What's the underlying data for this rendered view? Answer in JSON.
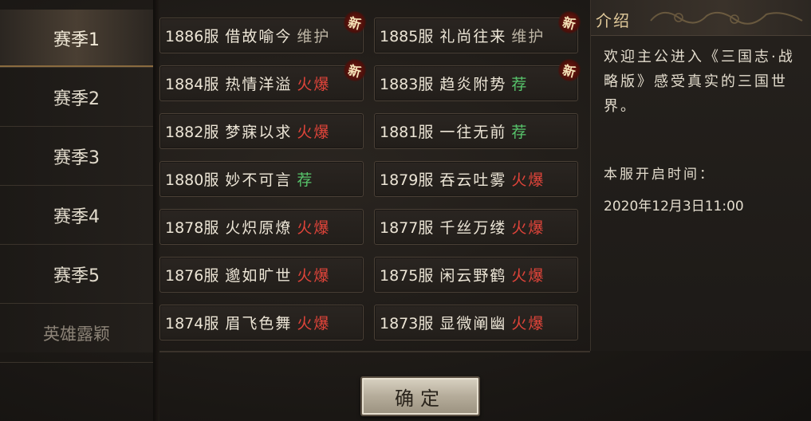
{
  "sidebar": {
    "seasons": [
      {
        "label": "赛季1",
        "active": true
      },
      {
        "label": "赛季2",
        "active": false
      },
      {
        "label": "赛季3",
        "active": false
      },
      {
        "label": "赛季4",
        "active": false
      },
      {
        "label": "赛季5",
        "active": false
      },
      {
        "label": "英雄露颖",
        "active": false
      }
    ]
  },
  "servers": [
    {
      "num": "1886服",
      "name": "借故喻今",
      "status": "维护",
      "status_type": "maintenance",
      "is_new": true,
      "new_label": "新"
    },
    {
      "num": "1885服",
      "name": "礼尚往来",
      "status": "维护",
      "status_type": "maintenance",
      "is_new": true,
      "new_label": "新"
    },
    {
      "num": "1884服",
      "name": "热情洋溢",
      "status": "火爆",
      "status_type": "hot",
      "is_new": true,
      "new_label": "新"
    },
    {
      "num": "1883服",
      "name": "趋炎附势",
      "status": "荐",
      "status_type": "recommended",
      "is_new": true,
      "new_label": "新"
    },
    {
      "num": "1882服",
      "name": "梦寐以求",
      "status": "火爆",
      "status_type": "hot",
      "is_new": false
    },
    {
      "num": "1881服",
      "name": "一往无前",
      "status": "荐",
      "status_type": "recommended",
      "is_new": false
    },
    {
      "num": "1880服",
      "name": "妙不可言",
      "status": "荐",
      "status_type": "recommended",
      "is_new": false
    },
    {
      "num": "1879服",
      "name": "吞云吐雾",
      "status": "火爆",
      "status_type": "hot",
      "is_new": false
    },
    {
      "num": "1878服",
      "name": "火炽原燎",
      "status": "火爆",
      "status_type": "hot",
      "is_new": false
    },
    {
      "num": "1877服",
      "name": "千丝万缕",
      "status": "火爆",
      "status_type": "hot",
      "is_new": false
    },
    {
      "num": "1876服",
      "name": "邈如旷世",
      "status": "火爆",
      "status_type": "hot",
      "is_new": false
    },
    {
      "num": "1875服",
      "name": "闲云野鹤",
      "status": "火爆",
      "status_type": "hot",
      "is_new": false
    },
    {
      "num": "1874服",
      "name": "眉飞色舞",
      "status": "火爆",
      "status_type": "hot",
      "is_new": false
    },
    {
      "num": "1873服",
      "name": "显微阐幽",
      "status": "火爆",
      "status_type": "hot",
      "is_new": false
    }
  ],
  "intro": {
    "title": "介绍",
    "text": "欢迎主公进入《三国志·战略版》感受真实的三国世界。",
    "open_label": "本服开启时间：",
    "open_time": "2020年12月3日11:00"
  },
  "colors": {
    "hot": "#e0443a",
    "recommended": "#57c46b",
    "maintenance": "#bcb4a4",
    "accent": "#8a6b3f"
  },
  "confirm_label": "确定"
}
